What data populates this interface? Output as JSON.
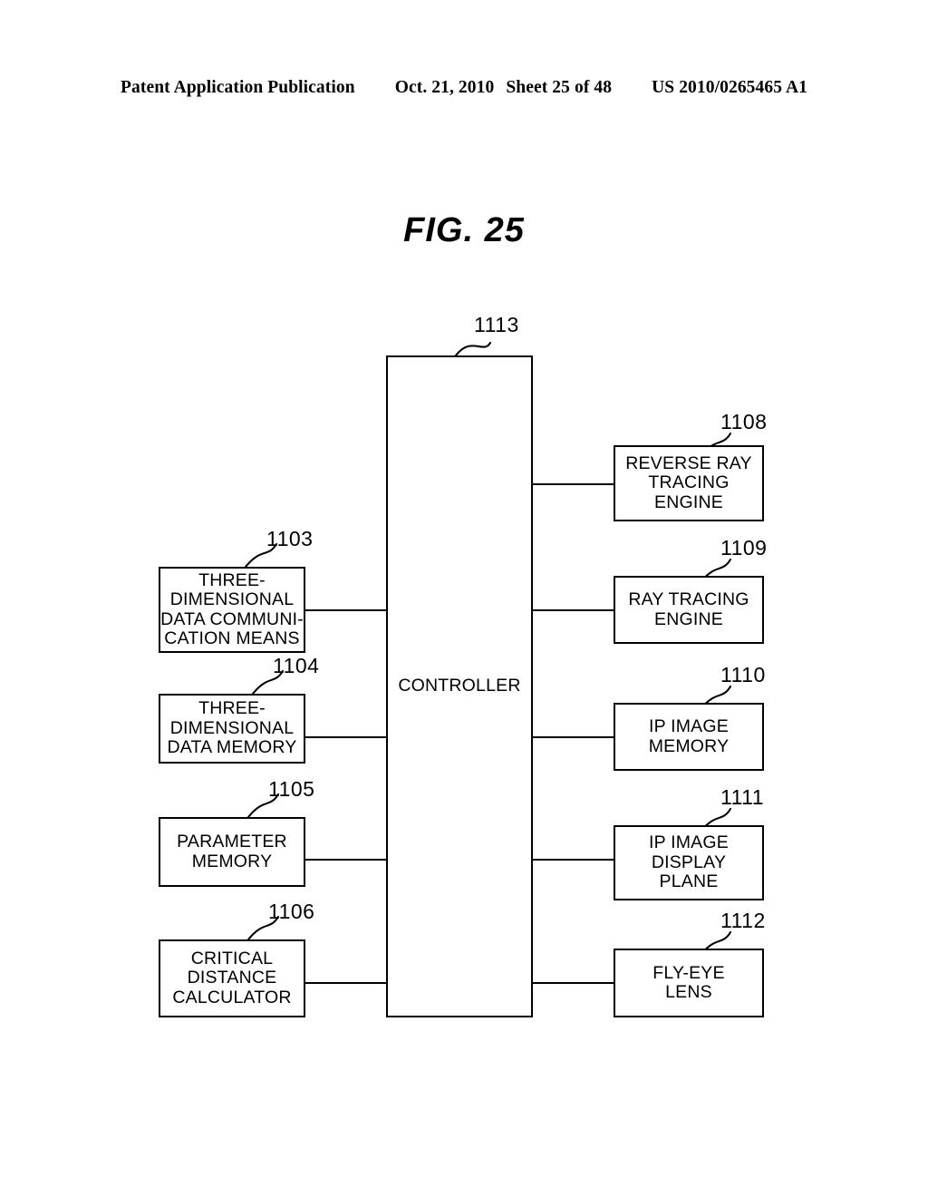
{
  "header": {
    "publication": "Patent Application Publication",
    "date": "Oct. 21, 2010",
    "sheet": "Sheet 25 of 48",
    "patent_number": "US 2010/0265465 A1"
  },
  "figure": {
    "title": "FIG. 25"
  },
  "diagram": {
    "controller": {
      "ref": "1113",
      "label": "CONTROLLER"
    },
    "left_blocks": [
      {
        "ref": "1103",
        "label": "THREE-\nDIMENSIONAL\nDATA COMMUNI-\nCATION MEANS"
      },
      {
        "ref": "1104",
        "label": "THREE-\nDIMENSIONAL\nDATA MEMORY"
      },
      {
        "ref": "1105",
        "label": "PARAMETER\nMEMORY"
      },
      {
        "ref": "1106",
        "label": "CRITICAL\nDISTANCE\nCALCULATOR"
      }
    ],
    "right_blocks": [
      {
        "ref": "1108",
        "label": "REVERSE RAY\nTRACING\nENGINE"
      },
      {
        "ref": "1109",
        "label": "RAY TRACING\nENGINE"
      },
      {
        "ref": "1110",
        "label": "IP IMAGE\nMEMORY"
      },
      {
        "ref": "1111",
        "label": "IP IMAGE\nDISPLAY\nPLANE"
      },
      {
        "ref": "1112",
        "label": "FLY-EYE\nLENS"
      }
    ]
  }
}
